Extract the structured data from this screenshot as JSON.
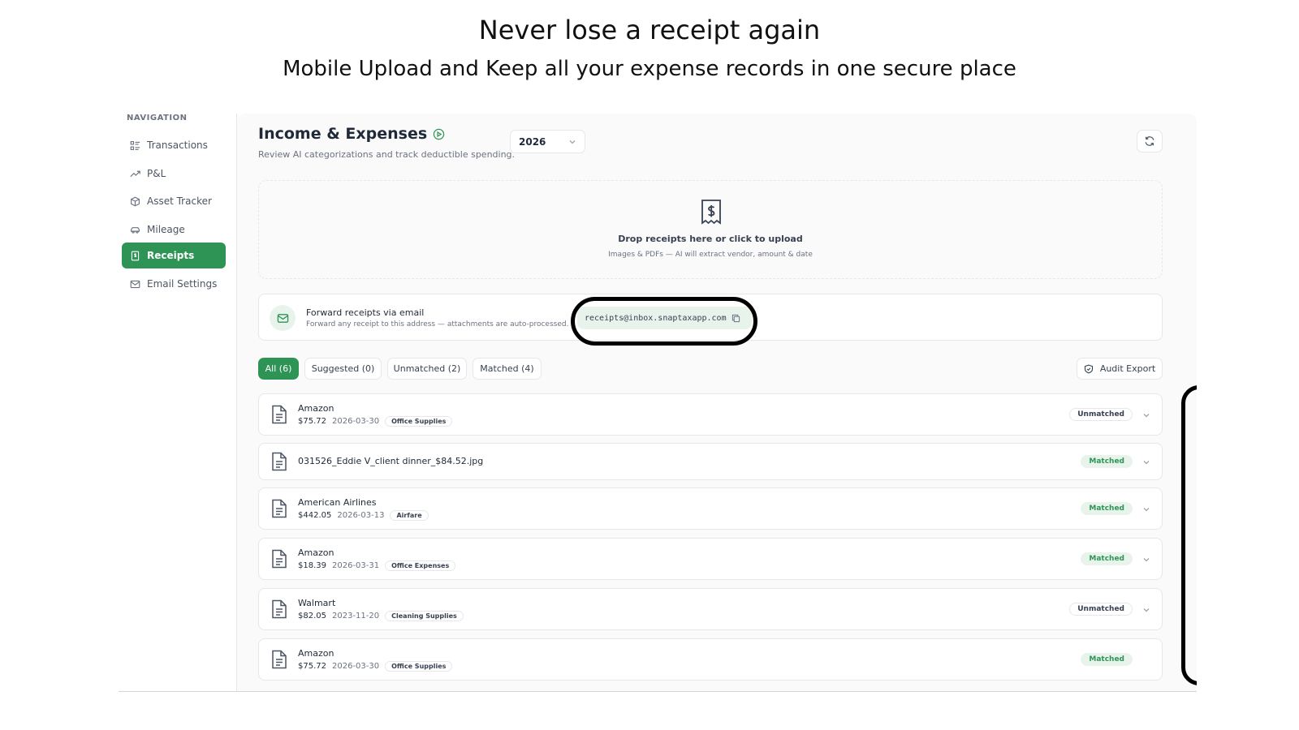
{
  "hero": {
    "title": "Never lose a receipt again",
    "subtitle": "Mobile Upload and Keep all your expense records in one secure place"
  },
  "sidebar": {
    "heading": "NAVIGATION",
    "items": [
      {
        "label": "Transactions",
        "icon": "list-icon",
        "active": false
      },
      {
        "label": "P&L",
        "icon": "trend-up-icon",
        "active": false
      },
      {
        "label": "Asset Tracker",
        "icon": "box-icon",
        "active": false
      },
      {
        "label": "Mileage",
        "icon": "car-icon",
        "active": false
      },
      {
        "label": "Receipts",
        "icon": "receipt-icon",
        "active": true
      },
      {
        "label": "Email Settings",
        "icon": "mail-icon",
        "active": false
      }
    ]
  },
  "header": {
    "title": "Income & Expenses",
    "subtitle": "Review AI categorizations and track deductible spending.",
    "year": "2026"
  },
  "dropzone": {
    "title": "Drop receipts here or click to upload",
    "subtitle": "Images & PDFs — AI will extract vendor, amount & date"
  },
  "forward": {
    "title": "Forward receipts via email",
    "subtitle": "Forward any receipt to this address — attachments are auto-processed.",
    "email": "receipts@inbox.snaptaxapp.com"
  },
  "tabs": [
    {
      "label": "All (6)",
      "active": true
    },
    {
      "label": "Suggested (0)",
      "active": false
    },
    {
      "label": "Unmatched (2)",
      "active": false
    },
    {
      "label": "Matched (4)",
      "active": false
    }
  ],
  "audit_export": "Audit Export",
  "receipts": [
    {
      "vendor": "Amazon",
      "amount": "$75.72",
      "date": "2026-03-30",
      "category": "Office Supplies",
      "status": "Unmatched"
    },
    {
      "vendor": "031526_Eddie V_client dinner_$84.52.jpg",
      "amount": "",
      "date": "",
      "category": "",
      "status": "Matched"
    },
    {
      "vendor": "American Airlines",
      "amount": "$442.05",
      "date": "2026-03-13",
      "category": "Airfare",
      "status": "Matched"
    },
    {
      "vendor": "Amazon",
      "amount": "$18.39",
      "date": "2026-03-31",
      "category": "Office Expenses",
      "status": "Matched"
    },
    {
      "vendor": "Walmart",
      "amount": "$82.05",
      "date": "2023-11-20",
      "category": "Cleaning Supplies",
      "status": "Unmatched"
    },
    {
      "vendor": "Amazon",
      "amount": "$75.72",
      "date": "2026-03-30",
      "category": "Office Supplies",
      "status": "Matched"
    }
  ],
  "colors": {
    "accent": "#2e9455",
    "accent_light": "#e8f3ec"
  }
}
